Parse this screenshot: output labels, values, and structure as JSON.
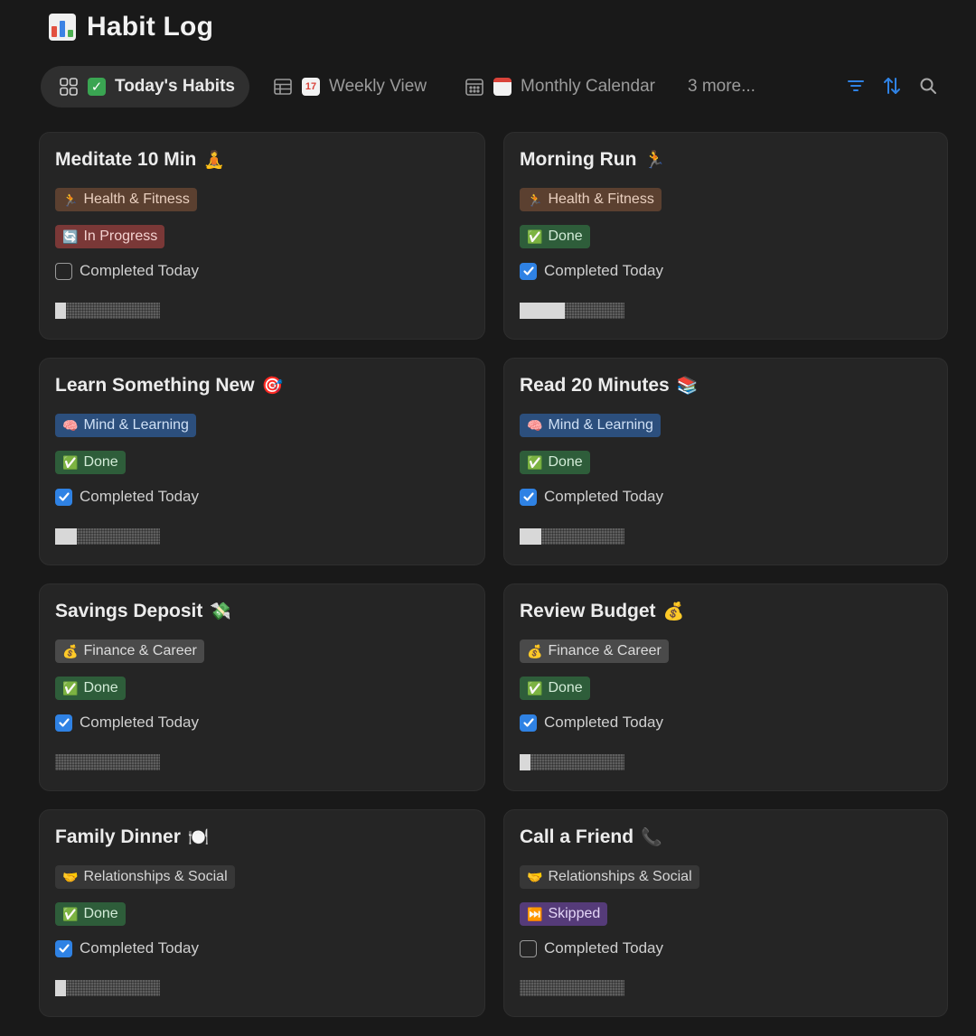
{
  "page": {
    "title": "Habit Log",
    "title_icon": "bar-chart-icon"
  },
  "tabs": [
    {
      "label": "Today's Habits",
      "view_icon": "gallery-icon",
      "emoji": "✅",
      "active": true
    },
    {
      "label": "Weekly View",
      "view_icon": "table-icon",
      "emoji": "📅",
      "active": false
    },
    {
      "label": "Monthly Calendar",
      "view_icon": "calendar-icon",
      "emoji": "🗓️",
      "active": false
    }
  ],
  "more_tabs_label": "3 more...",
  "toolbar": {
    "filter_icon": "filter-icon",
    "sort_icon": "sort-icon",
    "search_icon": "search-icon",
    "accent_color": "#2f82e4"
  },
  "colors": {
    "health": {
      "bg": "#5b4030",
      "fg": "#e9cfbf"
    },
    "mind": {
      "bg": "#2c4f7d",
      "fg": "#cfe0f5"
    },
    "finance": {
      "bg": "#4a4a4a",
      "fg": "#dcdcdc"
    },
    "social": {
      "bg": "#373737",
      "fg": "#d6d6d6"
    },
    "done": {
      "bg": "#2e5d3a",
      "fg": "#d3ecd8"
    },
    "in_progress": {
      "bg": "#7a3837",
      "fg": "#f3d2d0"
    },
    "skipped": {
      "bg": "#553b79",
      "fg": "#e4d6f7"
    }
  },
  "checkbox_label": "Completed Today",
  "habits": [
    {
      "name": "Meditate 10 Min",
      "emoji": "🧘",
      "category": "Health & Fitness",
      "category_emoji": "🏃",
      "category_key": "health",
      "status": "In Progress",
      "status_emoji": "🔄",
      "status_key": "in_progress",
      "completed": false,
      "progress": 0.1
    },
    {
      "name": "Morning Run",
      "emoji": "🏃",
      "category": "Health & Fitness",
      "category_emoji": "🏃",
      "category_key": "health",
      "status": "Done",
      "status_emoji": "✅",
      "status_key": "done",
      "completed": true,
      "progress": 0.43
    },
    {
      "name": "Learn Something New",
      "emoji": "🎯",
      "category": "Mind & Learning",
      "category_emoji": "🧠",
      "category_key": "mind",
      "status": "Done",
      "status_emoji": "✅",
      "status_key": "done",
      "completed": true,
      "progress": 0.21
    },
    {
      "name": "Read 20 Minutes",
      "emoji": "📚",
      "category": "Mind & Learning",
      "category_emoji": "🧠",
      "category_key": "mind",
      "status": "Done",
      "status_emoji": "✅",
      "status_key": "done",
      "completed": true,
      "progress": 0.21
    },
    {
      "name": "Savings Deposit",
      "emoji": "💸",
      "category": "Finance & Career",
      "category_emoji": "💰",
      "category_key": "finance",
      "status": "Done",
      "status_emoji": "✅",
      "status_key": "done",
      "completed": true,
      "progress": 0
    },
    {
      "name": "Review Budget",
      "emoji": "💰",
      "category": "Finance & Career",
      "category_emoji": "💰",
      "category_key": "finance",
      "status": "Done",
      "status_emoji": "✅",
      "status_key": "done",
      "completed": true,
      "progress": 0.1
    },
    {
      "name": "Family Dinner",
      "emoji": "🍽️",
      "category": "Relationships & Social",
      "category_emoji": "🤝",
      "category_key": "social",
      "status": "Done",
      "status_emoji": "✅",
      "status_key": "done",
      "completed": true,
      "progress": 0.1
    },
    {
      "name": "Call a Friend",
      "emoji": "📞",
      "category": "Relationships & Social",
      "category_emoji": "🤝",
      "category_key": "social",
      "status": "Skipped",
      "status_emoji": "⏭️",
      "status_key": "skipped",
      "completed": false,
      "progress": 0
    }
  ]
}
